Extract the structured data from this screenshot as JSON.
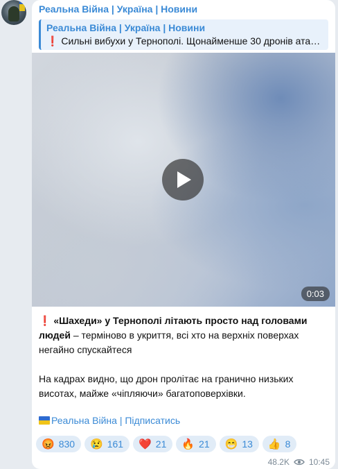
{
  "channel": {
    "name": "Реальна Війна | Україна | Новини"
  },
  "reply": {
    "title": "Реальна Війна | Україна | Новини",
    "excl": "❗",
    "text": "Сильні вибухи у Тернополі. Щонайменше 30 дронів атаку…"
  },
  "video": {
    "duration": "0:03"
  },
  "post": {
    "excl": "❗",
    "headline": "«Шахеди» у Тернополі літають просто над головами людей",
    "line1_rest": " – терміново в укриття, всі хто на верхніх поверхах негайно спускайтеся",
    "paragraph2": "На кадрах видно, що дрон пролітає на гранично низьких висотах, майже «чіпляючи» багатоповерхівки."
  },
  "signature": {
    "text": "Реальна Війна | Підписатись"
  },
  "reactions": [
    {
      "emoji": "😡",
      "count": "830"
    },
    {
      "emoji": "😢",
      "count": "161"
    },
    {
      "emoji": "❤️",
      "count": "21"
    },
    {
      "emoji": "🔥",
      "count": "21"
    },
    {
      "emoji": "😁",
      "count": "13"
    },
    {
      "emoji": "👍",
      "count": "8"
    }
  ],
  "meta": {
    "views": "48.2K",
    "time": "10:45"
  }
}
